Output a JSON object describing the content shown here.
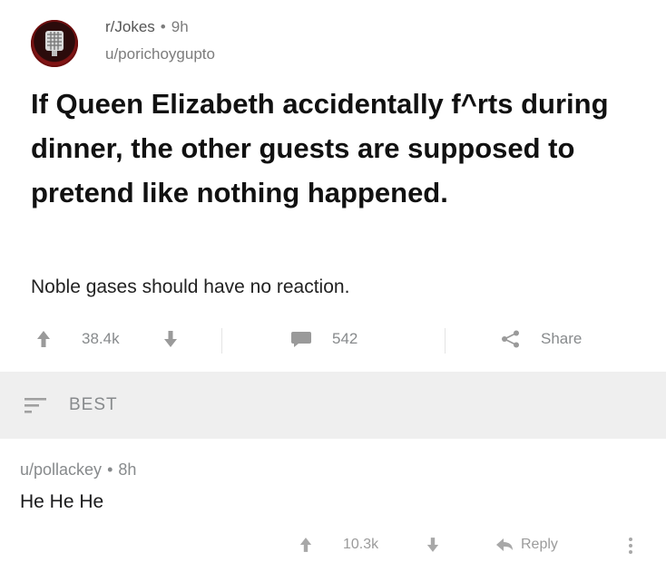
{
  "post": {
    "subreddit": "r/Jokes",
    "age": "9h",
    "author": "u/porichoygupto",
    "title": "If Queen Elizabeth accidentally f^rts during dinner, the other guests are supposed to pretend like nothing happened.",
    "body": "Noble gases should have no reaction.",
    "upvotes": "38.4k",
    "comments": "542",
    "share_label": "Share"
  },
  "sort": {
    "label": "BEST"
  },
  "comment": {
    "author": "u/pollackey",
    "age": "8h",
    "body": "He He He",
    "upvotes": "10.3k",
    "reply_label": "Reply"
  },
  "separator": "•"
}
